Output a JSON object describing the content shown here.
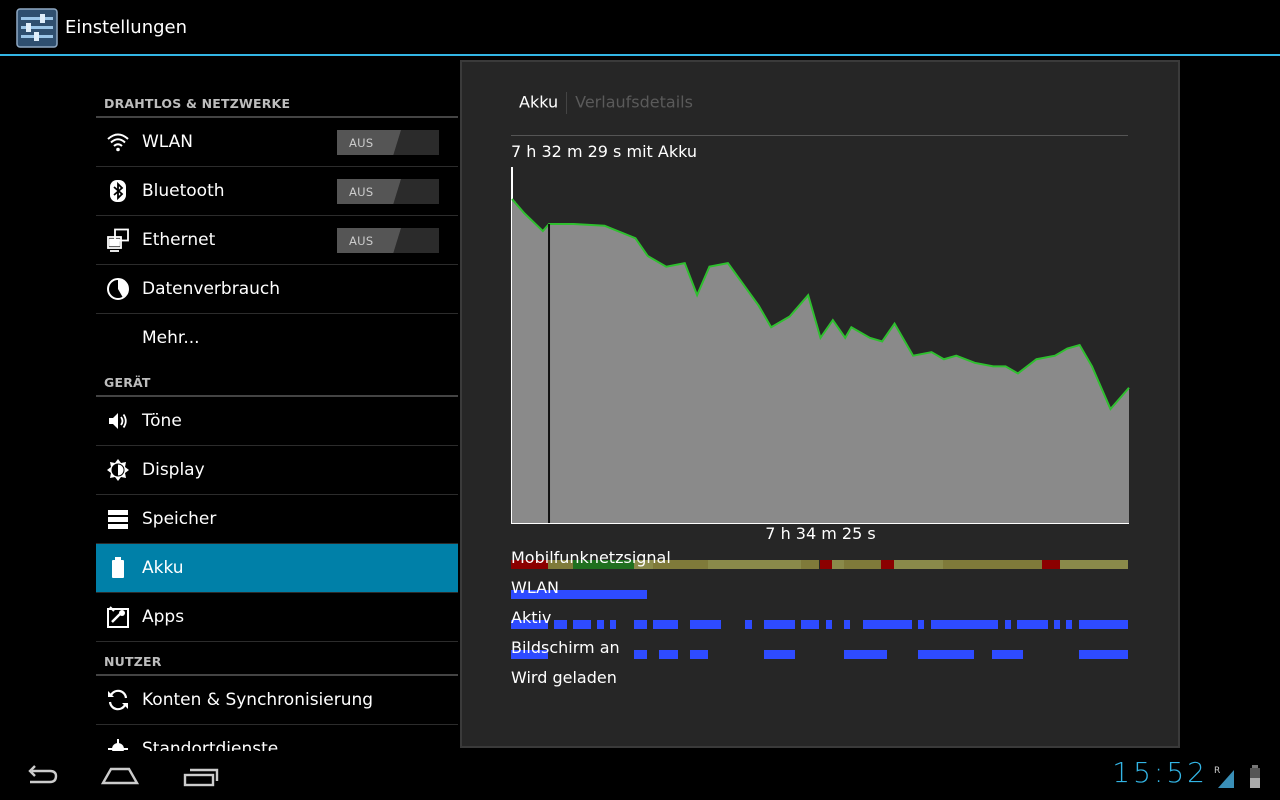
{
  "actionbar": {
    "title": "Einstellungen",
    "icon": "settings-sliders-icon"
  },
  "menu": {
    "sections": [
      {
        "header": "DRAHTLOS & NETZWERKE",
        "items": [
          {
            "label": "WLAN",
            "icon": "wifi-icon",
            "toggle": "AUS"
          },
          {
            "label": "Bluetooth",
            "icon": "bluetooth-icon",
            "toggle": "AUS"
          },
          {
            "label": "Ethernet",
            "icon": "ethernet-icon",
            "toggle": "AUS"
          },
          {
            "label": "Datenverbrauch",
            "icon": "data-usage-icon"
          },
          {
            "label": "Mehr..."
          }
        ]
      },
      {
        "header": "GERÄT",
        "items": [
          {
            "label": "Töne",
            "icon": "speaker-icon"
          },
          {
            "label": "Display",
            "icon": "brightness-icon"
          },
          {
            "label": "Speicher",
            "icon": "storage-icon"
          },
          {
            "label": "Akku",
            "icon": "battery-icon",
            "selected": true
          },
          {
            "label": "Apps",
            "icon": "apps-icon"
          }
        ]
      },
      {
        "header": "NUTZER",
        "items": [
          {
            "label": "Konten & Synchronisierung",
            "icon": "sync-icon"
          },
          {
            "label": "Standortdienste",
            "icon": "location-icon"
          }
        ]
      }
    ]
  },
  "panel": {
    "tabs": [
      "Akku",
      "Verlaufsdetails"
    ],
    "on_battery_text": "7 h 32 m 29 s mit Akku",
    "chart_xlabel": "7 h 34 m 25 s",
    "signal_rows": [
      "Mobilfunknetzsignal",
      "WLAN",
      "Aktiv",
      "Bildschirm an",
      "Wird geladen"
    ]
  },
  "chart_data": {
    "type": "area",
    "title": "7 h 32 m 29 s mit Akku",
    "xlabel": "7 h 34 m 25 s",
    "ylabel": "",
    "ylim": [
      0,
      100
    ],
    "x_unit": "fraction of elapsed time",
    "y_unit": "battery percent",
    "x": [
      0,
      0.02,
      0.05,
      0.06,
      0.1,
      0.15,
      0.2,
      0.22,
      0.25,
      0.28,
      0.3,
      0.32,
      0.35,
      0.4,
      0.42,
      0.45,
      0.48,
      0.5,
      0.52,
      0.54,
      0.55,
      0.58,
      0.6,
      0.62,
      0.65,
      0.68,
      0.7,
      0.72,
      0.75,
      0.78,
      0.8,
      0.82,
      0.85,
      0.88,
      0.9,
      0.92,
      0.94,
      0.95,
      0.97,
      1.0
    ],
    "values": [
      91,
      87,
      82,
      84,
      84,
      83.5,
      80,
      75,
      72,
      73,
      64,
      72,
      73,
      61,
      55,
      58,
      64,
      52,
      57,
      52,
      55,
      52,
      51,
      56,
      47,
      48,
      46,
      47,
      45,
      44,
      44,
      42,
      46,
      47,
      49,
      50,
      44,
      40,
      32,
      38
    ],
    "signal_bars": {
      "Mobilfunknetzsignal": {
        "color_scale": [
          "#8b0000",
          "#1f6f1f",
          "#7f7a3a",
          "#8a8a4a"
        ]
      },
      "WLAN": {
        "segments": [
          [
            0,
            0.22
          ]
        ]
      },
      "Aktiv": {
        "segments": [
          [
            0,
            0.06
          ],
          [
            0.07,
            0.09
          ],
          [
            0.1,
            0.13
          ],
          [
            0.14,
            0.15
          ],
          [
            0.16,
            0.17
          ],
          [
            0.2,
            0.22
          ],
          [
            0.23,
            0.27
          ],
          [
            0.29,
            0.34
          ],
          [
            0.38,
            0.39
          ],
          [
            0.41,
            0.46
          ],
          [
            0.47,
            0.5
          ],
          [
            0.51,
            0.52
          ],
          [
            0.54,
            0.55
          ],
          [
            0.57,
            0.65
          ],
          [
            0.66,
            0.67
          ],
          [
            0.68,
            0.79
          ],
          [
            0.8,
            0.81
          ],
          [
            0.82,
            0.87
          ],
          [
            0.88,
            0.89
          ],
          [
            0.9,
            0.91
          ],
          [
            0.92,
            1.0
          ]
        ]
      },
      "Bildschirm an": {
        "segments": [
          [
            0,
            0.06
          ],
          [
            0.2,
            0.22
          ],
          [
            0.24,
            0.27
          ],
          [
            0.29,
            0.32
          ],
          [
            0.41,
            0.46
          ],
          [
            0.54,
            0.61
          ],
          [
            0.66,
            0.75
          ],
          [
            0.78,
            0.83
          ],
          [
            0.92,
            1.0
          ]
        ]
      },
      "Wird geladen": {
        "segments": []
      }
    }
  },
  "navbar": {
    "buttons": [
      "back-icon",
      "home-icon",
      "recent-apps-icon"
    ],
    "clock": "15:52"
  },
  "status": {
    "signal_marker": "R"
  }
}
